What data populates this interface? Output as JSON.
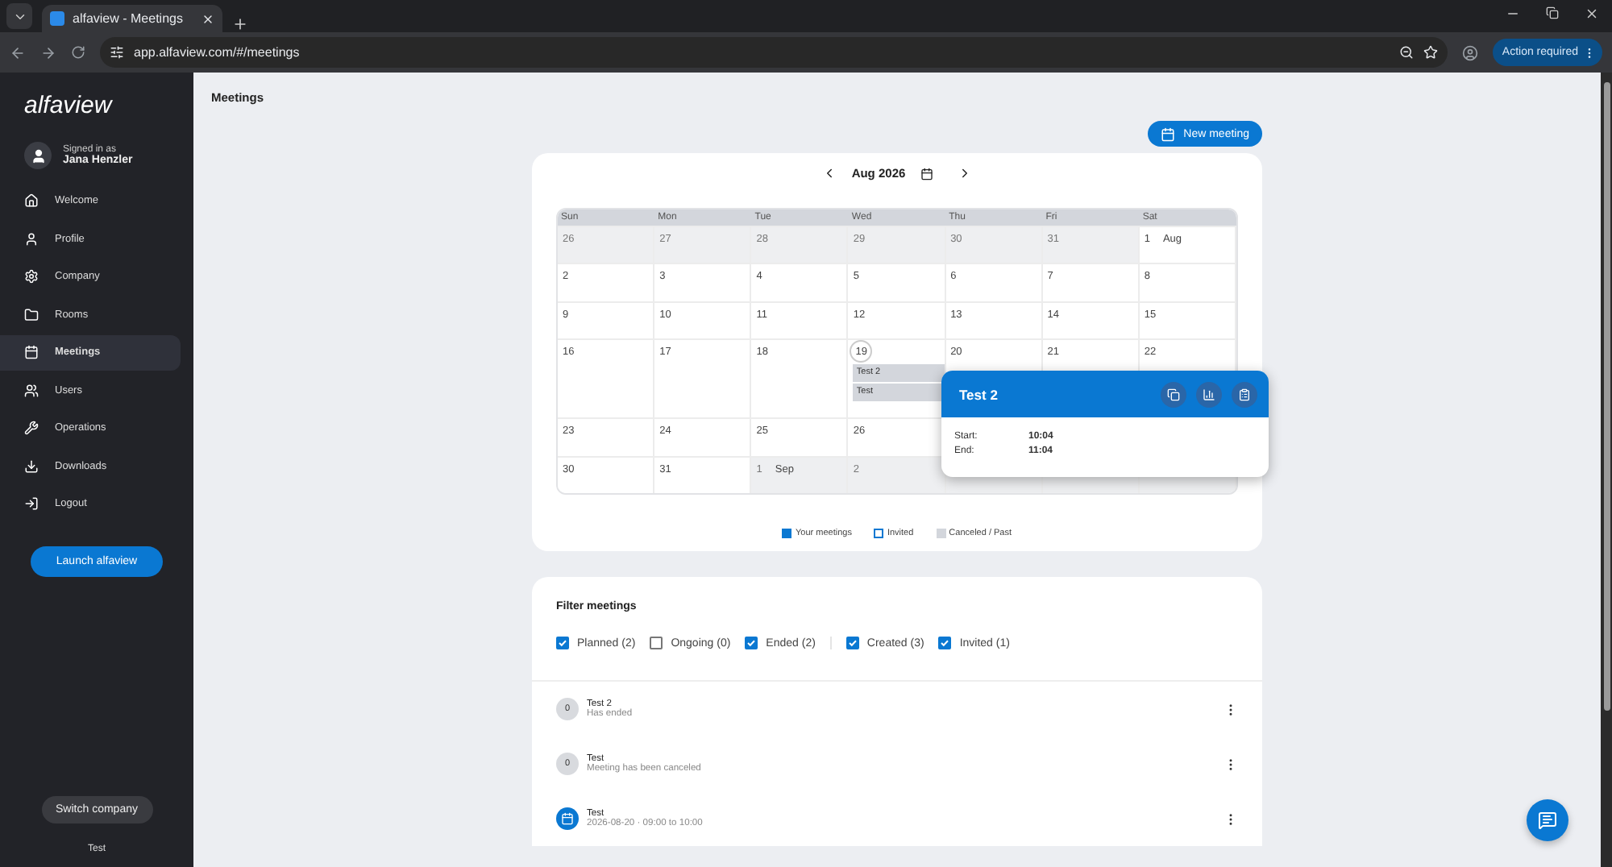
{
  "browser": {
    "tab_title": "alfaview - Meetings",
    "url": "app.alfaview.com/#/meetings",
    "action_button": "Action required"
  },
  "sidebar": {
    "logo": "alfaview",
    "signed_in_label": "Signed in as",
    "user_name": "Jana Henzler",
    "items": [
      {
        "label": "Welcome",
        "selected": false
      },
      {
        "label": "Profile",
        "selected": false
      },
      {
        "label": "Company",
        "selected": false
      },
      {
        "label": "Rooms",
        "selected": false
      },
      {
        "label": "Meetings",
        "selected": true
      },
      {
        "label": "Users",
        "selected": false
      },
      {
        "label": "Operations",
        "selected": false
      },
      {
        "label": "Downloads",
        "selected": false
      },
      {
        "label": "Logout",
        "selected": false
      }
    ],
    "launch_button": "Launch alfaview",
    "switch_button": "Switch company",
    "company": "Test"
  },
  "page_title": "Meetings",
  "new_meeting_button": "New meeting",
  "calendar": {
    "month": "Aug 2026",
    "weekdays": [
      "Sun",
      "Mon",
      "Tue",
      "Wed",
      "Thu",
      "Fri",
      "Sat"
    ],
    "weeks": [
      [
        {
          "day": "26",
          "outside": true
        },
        {
          "day": "27",
          "outside": true
        },
        {
          "day": "28",
          "outside": true
        },
        {
          "day": "29",
          "outside": true
        },
        {
          "day": "30",
          "outside": true
        },
        {
          "day": "31",
          "outside": true
        },
        {
          "day": "1",
          "month_label": "Aug",
          "outside": false
        }
      ],
      [
        {
          "day": "2",
          "outside": false
        },
        {
          "day": "3",
          "outside": false
        },
        {
          "day": "4",
          "outside": false
        },
        {
          "day": "5",
          "outside": false
        },
        {
          "day": "6",
          "outside": false
        },
        {
          "day": "7",
          "outside": false
        },
        {
          "day": "8",
          "outside": false
        }
      ],
      [
        {
          "day": "9",
          "outside": false
        },
        {
          "day": "10",
          "outside": false
        },
        {
          "day": "11",
          "outside": false
        },
        {
          "day": "12",
          "outside": false
        },
        {
          "day": "13",
          "outside": false
        },
        {
          "day": "14",
          "outside": false
        },
        {
          "day": "15",
          "outside": false
        }
      ],
      [
        {
          "day": "16",
          "outside": false
        },
        {
          "day": "17",
          "outside": false
        },
        {
          "day": "18",
          "outside": false
        },
        {
          "day": "19",
          "outside": false,
          "today": true,
          "events": [
            {
              "title": "Test 2",
              "kind": "past"
            },
            {
              "title": "Test",
              "kind": "past"
            }
          ]
        },
        {
          "day": "20",
          "outside": false
        },
        {
          "day": "21",
          "outside": false
        },
        {
          "day": "22",
          "outside": false
        }
      ],
      [
        {
          "day": "23",
          "outside": false
        },
        {
          "day": "24",
          "outside": false
        },
        {
          "day": "25",
          "outside": false
        },
        {
          "day": "26",
          "outside": false
        }
      ],
      [
        {
          "day": "30",
          "outside": false
        },
        {
          "day": "31",
          "outside": false
        },
        {
          "day": "1",
          "month_label": "Sep",
          "outside": true
        },
        {
          "day": "2",
          "outside": true
        },
        {
          "outside": true
        },
        {
          "outside": true
        },
        {
          "outside": true
        }
      ]
    ],
    "popover": {
      "title": "Test 2",
      "rows": [
        {
          "label": "Start:",
          "value": "10:04"
        },
        {
          "label": "End:",
          "value": "11:04"
        }
      ]
    },
    "legend": [
      {
        "label": "Your meetings",
        "kind": "own"
      },
      {
        "label": "Invited",
        "kind": "invited"
      },
      {
        "label": "Canceled / Past",
        "kind": "past"
      }
    ]
  },
  "filter": {
    "title": "Filter meetings",
    "groups": [
      [
        {
          "label": "Planned (2)",
          "checked": true
        },
        {
          "label": "Ongoing (0)",
          "checked": false
        },
        {
          "label": "Ended (2)",
          "checked": true
        }
      ],
      [
        {
          "label": "Created (3)",
          "checked": true
        },
        {
          "label": "Invited (1)",
          "checked": true
        }
      ]
    ]
  },
  "meetings": [
    {
      "kind": "count",
      "badge": "0",
      "title": "Test 2",
      "subtitle": "Has ended"
    },
    {
      "kind": "count",
      "badge": "0",
      "title": "Test",
      "subtitle": "Meeting has been canceled"
    },
    {
      "kind": "planned",
      "title": "Test",
      "subtitle": "2026-08-20 · 09:00 to 10:00"
    }
  ]
}
